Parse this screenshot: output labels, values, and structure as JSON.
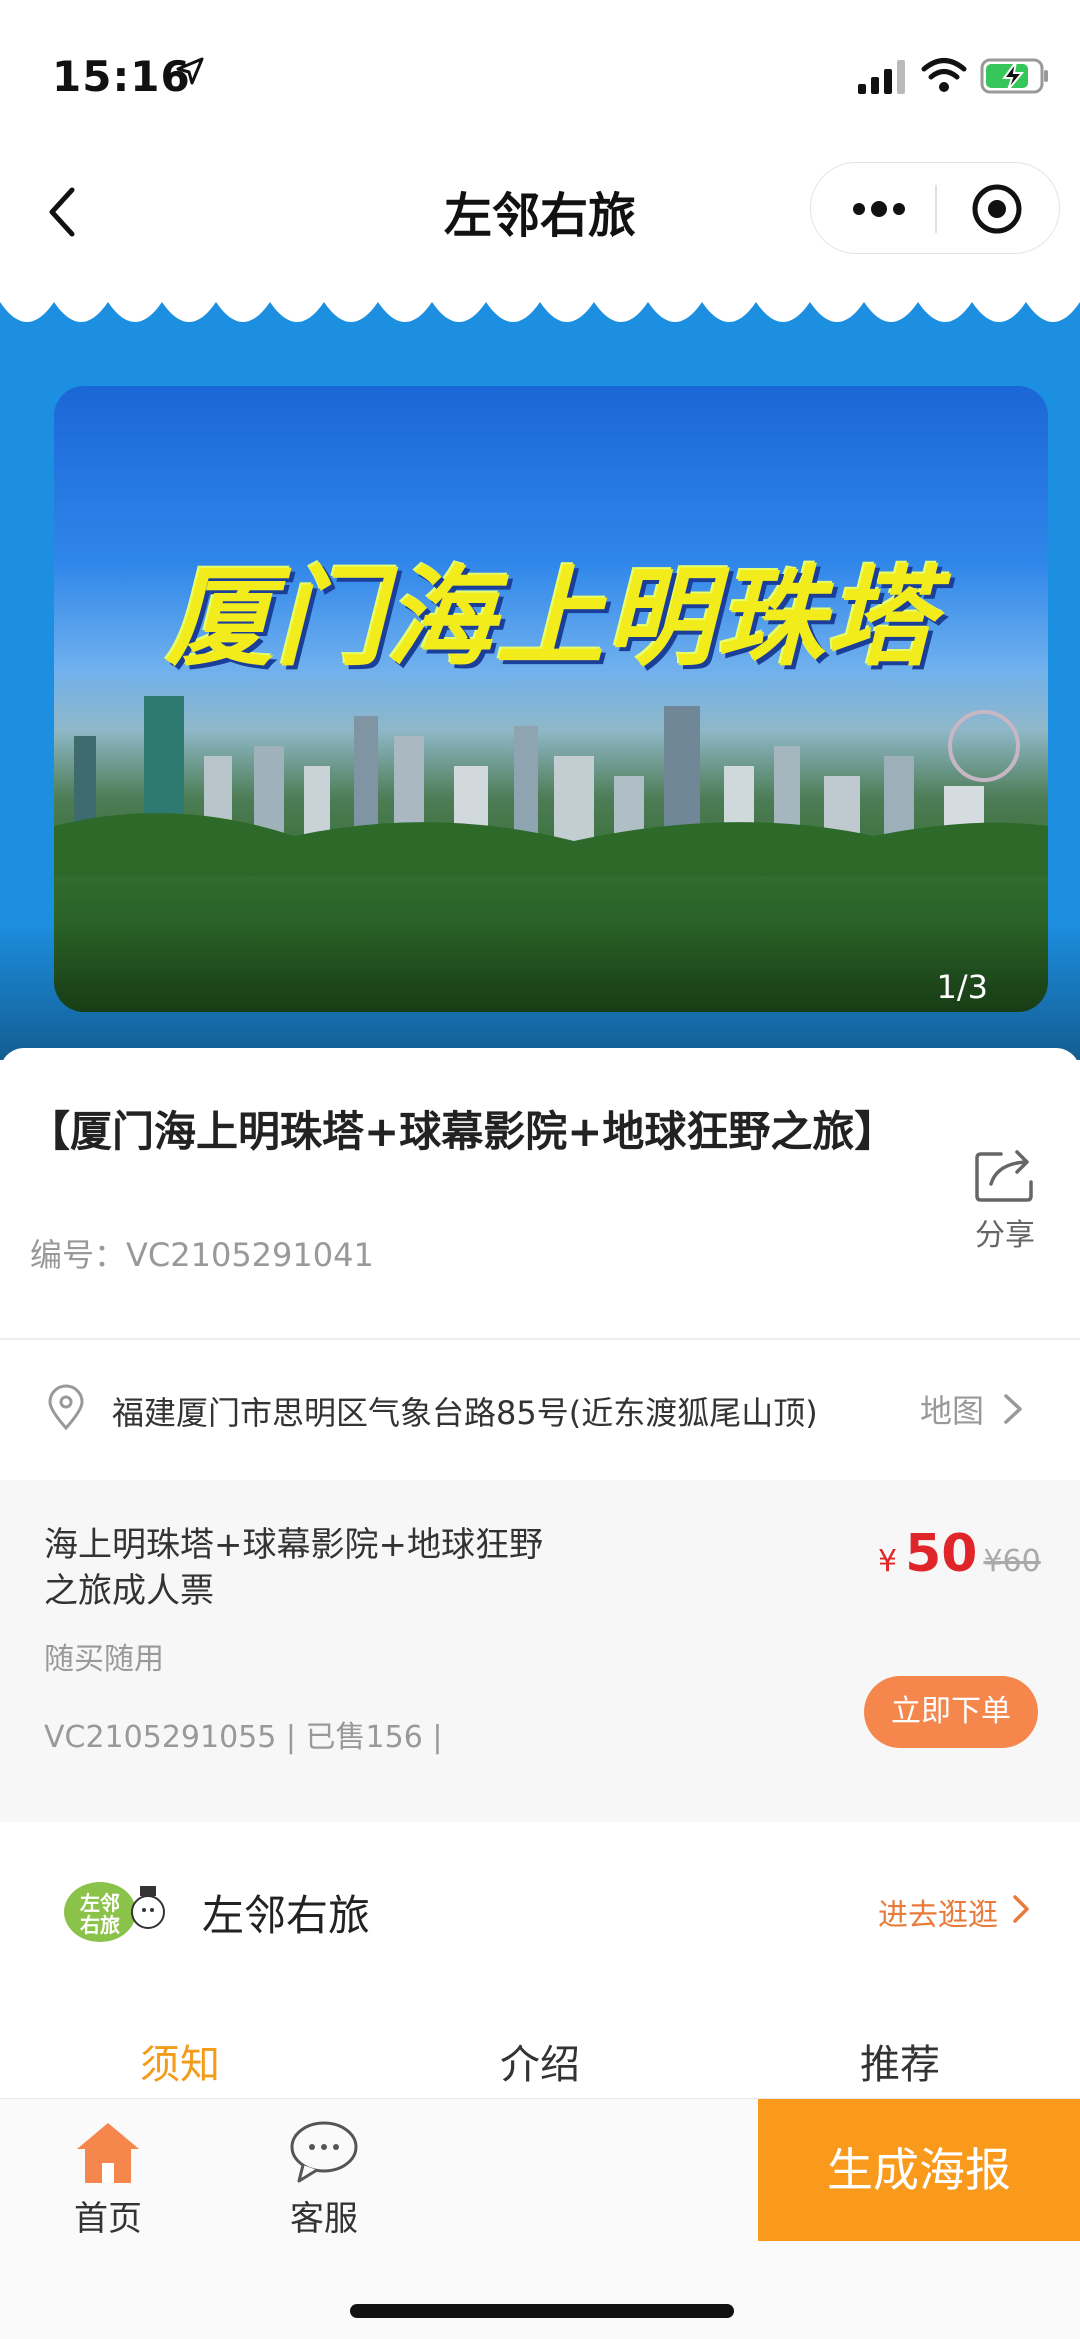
{
  "status_bar": {
    "time": "15:16"
  },
  "nav": {
    "title": "左邻右旅"
  },
  "banner": {
    "overlay_title": "厦门海上明珠塔",
    "counter": "1/3"
  },
  "product": {
    "title": "【厦门海上明珠塔+球幕影院+地球狂野之旅】",
    "code": "编号：VC2105291041",
    "share_label": "分享"
  },
  "address": {
    "text": "福建厦门市思明区气象台路85号(近东渡狐尾山顶)",
    "map_label": "地图"
  },
  "ticket": {
    "name": "海上明珠塔+球幕影院+地球狂野之旅成人票",
    "usage": "随买随用",
    "meta": "VC2105291055 | 已售156 |",
    "currency": "¥",
    "price": "50",
    "original_price": "¥60",
    "order_label": "立即下单"
  },
  "shop": {
    "name": "左邻右旅",
    "link_label": "进去逛逛"
  },
  "tabs": [
    {
      "label": "须知",
      "active": true
    },
    {
      "label": "介绍",
      "active": false
    },
    {
      "label": "推荐",
      "active": false
    }
  ],
  "bottom_bar": {
    "home_label": "首页",
    "service_label": "客服",
    "poster_label": "生成海报"
  },
  "colors": {
    "accent_orange": "#f99a1c",
    "price_red": "#e0252a",
    "tab_active": "#f39b1b",
    "banner_blue": "#1d8fe0"
  },
  "icons": [
    "location-arrow-icon",
    "signal-icon",
    "wifi-icon",
    "battery-charging-icon",
    "back-icon",
    "more-dots-icon",
    "target-icon",
    "share-icon",
    "location-pin-icon",
    "chevron-right-icon",
    "home-icon",
    "chat-bubble-icon"
  ]
}
